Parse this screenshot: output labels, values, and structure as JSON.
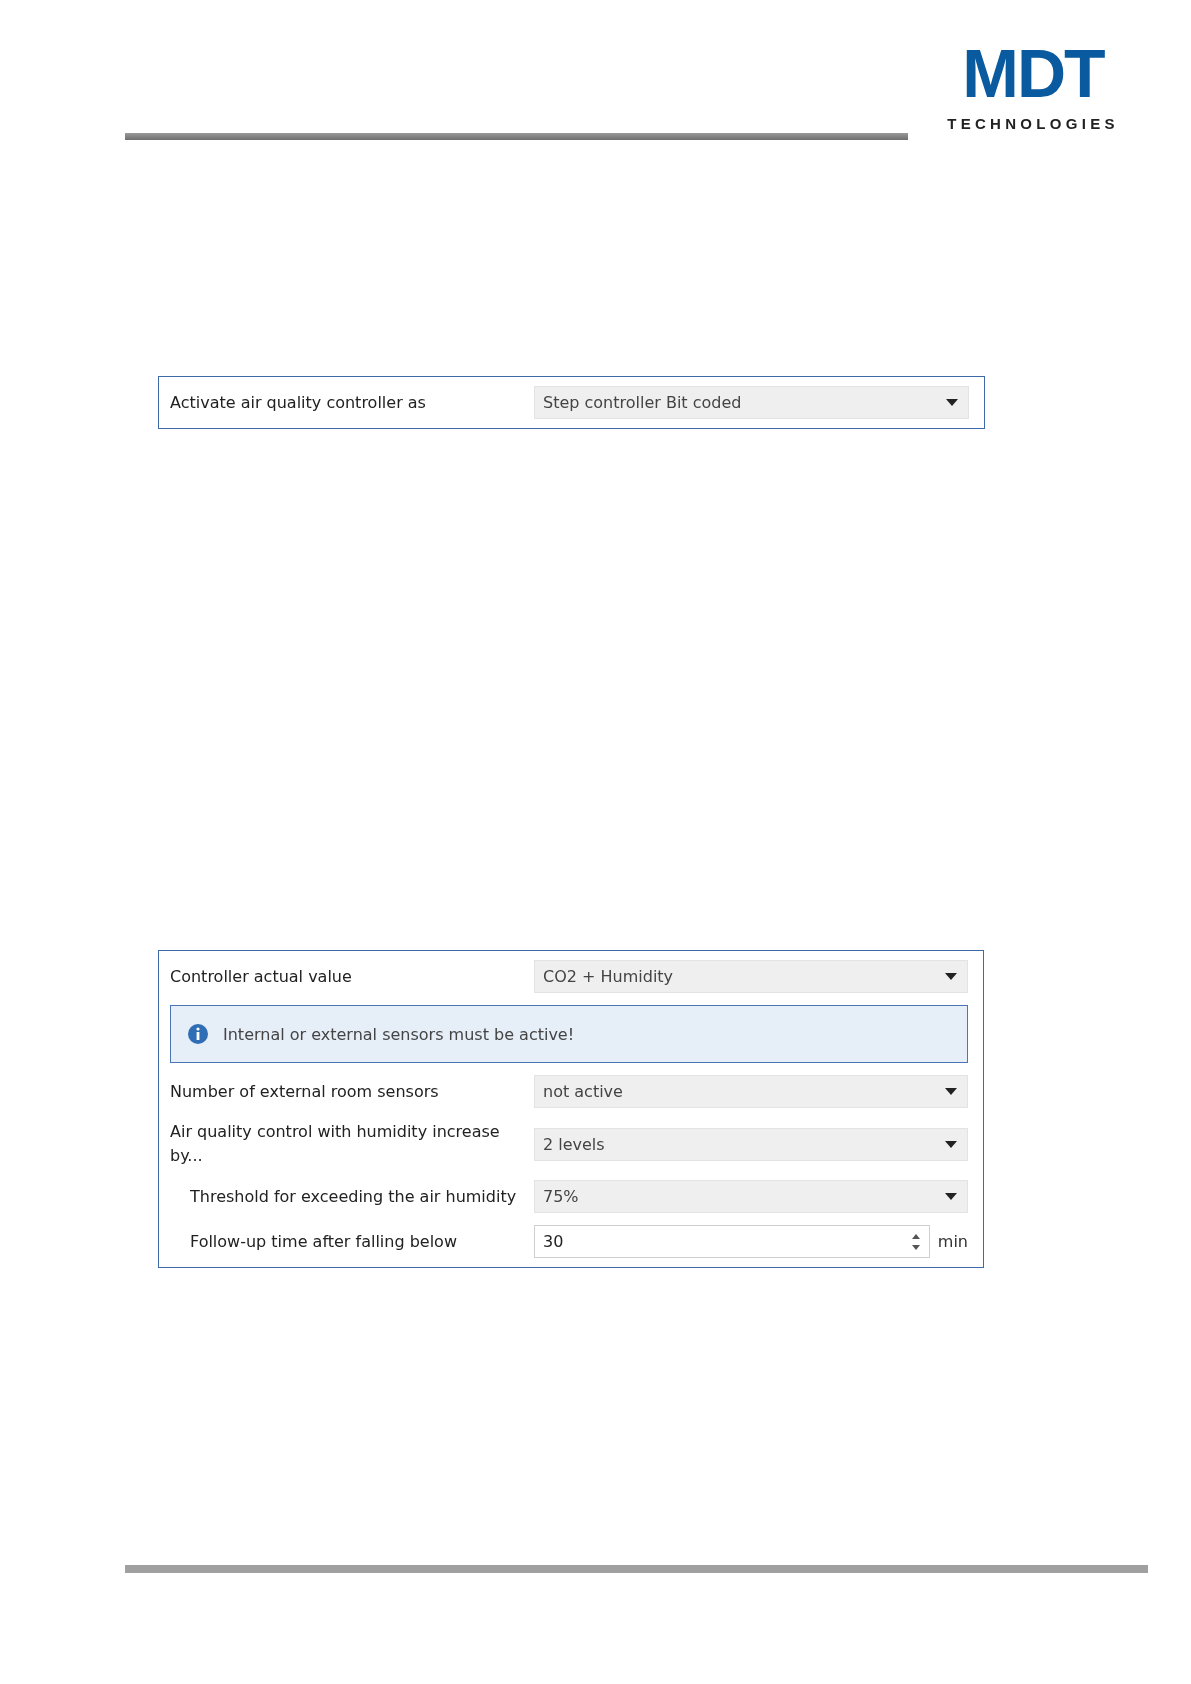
{
  "logo": {
    "brand": "MDT",
    "tagline": "TECHNOLOGIES"
  },
  "panels": [
    {
      "rows": [
        {
          "kind": "select",
          "label": "Activate air quality controller as",
          "value": "Step controller Bit coded"
        }
      ]
    },
    {
      "rows": [
        {
          "kind": "select",
          "label": "Controller actual value",
          "value": "CO2 + Humidity"
        },
        {
          "kind": "info",
          "text": "Internal or external sensors must be active!"
        },
        {
          "kind": "select",
          "label": "Number of external room sensors",
          "value": "not active"
        },
        {
          "kind": "select",
          "label": "Air quality control with humidity increase by...",
          "value": "2 levels",
          "children": [
            {
              "kind": "select",
              "label": "Threshold for exceeding the air humidity",
              "value": "75%"
            },
            {
              "kind": "spin",
              "label": "Follow-up time after falling below",
              "value": "30",
              "unit": "min"
            }
          ]
        }
      ]
    }
  ]
}
